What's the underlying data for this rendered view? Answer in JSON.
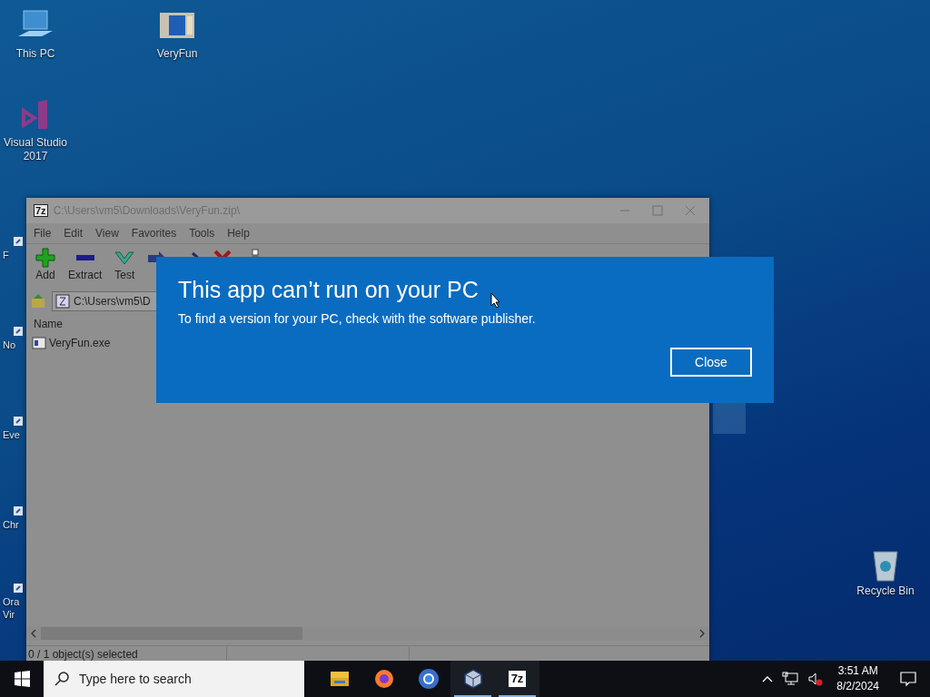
{
  "desktop_icons": [
    {
      "label": "This PC",
      "kind": "pc"
    },
    {
      "label": "VeryFun",
      "kind": "app"
    },
    {
      "label": "Visual Studio 2017",
      "kind": "vs"
    },
    {
      "label": "Recycle Bin",
      "kind": "bin"
    }
  ],
  "partial_icons": [
    {
      "lines": [
        "F"
      ]
    },
    {
      "lines": [
        "No"
      ]
    },
    {
      "lines": [
        "Eve"
      ]
    },
    {
      "lines": [
        "Chr"
      ]
    },
    {
      "lines": [
        "Ora",
        "Vir"
      ]
    }
  ],
  "archive_window": {
    "title_icon": "7z",
    "title": "C:\\Users\\vm5\\Downloads\\VeryFun.zip\\",
    "menu": [
      "File",
      "Edit",
      "View",
      "Favorites",
      "Tools",
      "Help"
    ],
    "toolbar": [
      {
        "kind": "add",
        "label": "Add"
      },
      {
        "kind": "extract",
        "label": "Extract"
      },
      {
        "kind": "test",
        "label": "Test"
      },
      {
        "kind": "copy"
      },
      {
        "kind": "move"
      },
      {
        "kind": "delete"
      },
      {
        "kind": "info"
      }
    ],
    "address": "C:\\Users\\vm5\\D",
    "columns": [
      "Name"
    ],
    "files": [
      {
        "name": "VeryFun.exe",
        "selected": false
      }
    ],
    "status": "0 / 1 object(s) selected"
  },
  "dialog": {
    "title": "This app can’t run on your PC",
    "message": "To find a version for your PC, check with the software publisher.",
    "button": "Close"
  },
  "taskbar": {
    "search_placeholder": "Type here to search",
    "apps": [
      {
        "kind": "explorer",
        "running": false
      },
      {
        "kind": "firefox",
        "running": false
      },
      {
        "kind": "chrome",
        "running": false
      },
      {
        "kind": "virtualbox",
        "running": true
      },
      {
        "kind": "sevenzip",
        "label": "7z",
        "running": true
      }
    ],
    "volume_muted": true,
    "time": "3:51 AM",
    "date": "8/2/2024"
  }
}
